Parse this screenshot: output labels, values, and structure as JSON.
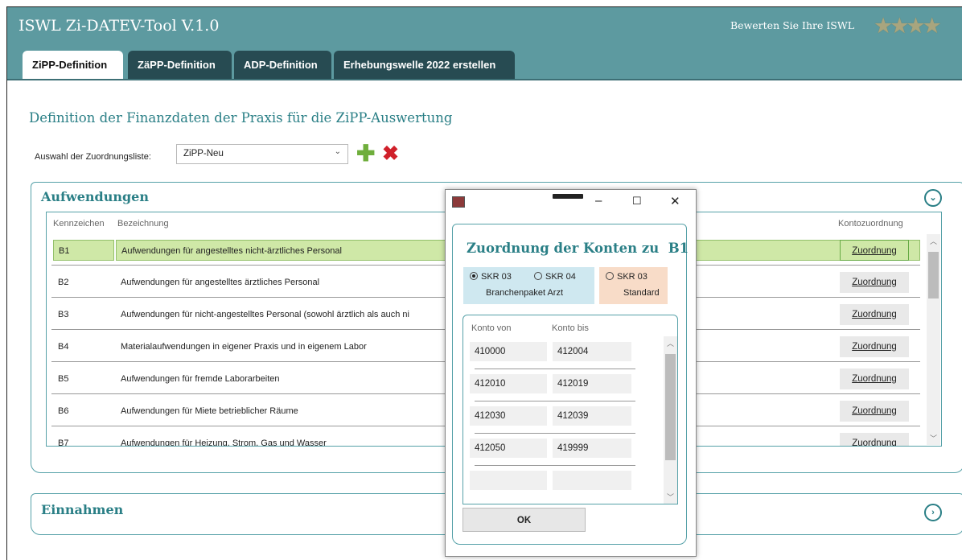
{
  "app": {
    "title": "ISWL Zi-DATEV-Tool V.1.0",
    "rate_text": "Bewerten Sie Ihre ISWL",
    "stars": 4
  },
  "tabs": [
    {
      "label": "ZiPP-Definition",
      "active": true
    },
    {
      "label": "ZäPP-Definition"
    },
    {
      "label": "ADP-Definition"
    },
    {
      "label": "Erhebungswelle 2022 erstellen"
    }
  ],
  "page": {
    "heading": "Definition der Finanzdaten der Praxis für die ZiPP-Auswertung",
    "select_label": "Auswahl der Zuordnungsliste:",
    "select_value": "ZiPP-Neu"
  },
  "aufwendungen": {
    "title": "Aufwendungen",
    "columns": {
      "kennzeichen": "Kennzeichen",
      "bezeichnung": "Bezeichnung",
      "kontozuordnung": "Kontozuordnung"
    },
    "rows": [
      {
        "kz": "B1",
        "text": "Aufwendungen für angestelltes nicht-ärztliches Personal",
        "btn": "Zuordnung",
        "selected": true
      },
      {
        "kz": "B2",
        "text": "Aufwendungen für angestelltes ärztliches Personal",
        "btn": "Zuordnung"
      },
      {
        "kz": "B3",
        "text": "Aufwendungen für nicht-angestelltes Personal (sowohl ärztlich als auch ni",
        "btn": "Zuordnung"
      },
      {
        "kz": "B4",
        "text": "Materialaufwendungen in eigener Praxis und in eigenem Labor",
        "btn": "Zuordnung"
      },
      {
        "kz": "B5",
        "text": "Aufwendungen für fremde Laborarbeiten",
        "btn": "Zuordnung"
      },
      {
        "kz": "B6",
        "text": "Aufwendungen für Miete betrieblicher Räume",
        "btn": "Zuordnung"
      },
      {
        "kz": "B7",
        "text": "Aufwendungen für Heizung, Strom, Gas und Wasser",
        "btn": "Zuordnung"
      }
    ]
  },
  "einnahmen": {
    "title": "Einnahmen"
  },
  "dialog": {
    "title": "Zuordnung der Konten zu  B1",
    "radio1_label": "SKR 03",
    "radio1_sub": "Branchenpaket Arzt",
    "radio2_label": "SKR 04",
    "radio3_label": "SKR 03",
    "radio3_sub": "Standard",
    "col_von": "Konto von",
    "col_bis": "Konto bis",
    "rows": [
      {
        "von": "410000",
        "bis": "412004"
      },
      {
        "von": "412010",
        "bis": "412019"
      },
      {
        "von": "412030",
        "bis": "412039"
      },
      {
        "von": "412050",
        "bis": "419999"
      },
      {
        "von": "",
        "bis": ""
      }
    ],
    "ok_label": "OK"
  }
}
